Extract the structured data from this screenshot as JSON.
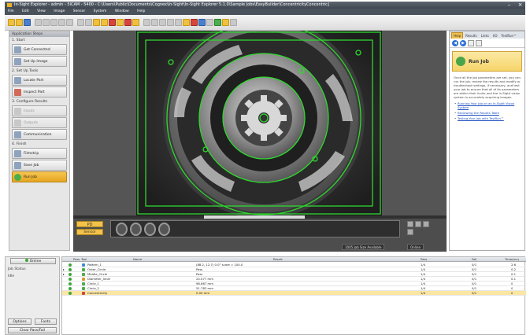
{
  "window": {
    "title": "In-Sight Explorer - admin - 5ICAM - 5400 - C:\\Users\\Public\\Documents\\Cognex\\In-Sight\\In-Sight Explorer 5.1.0\\Sample Jobs\\EasyBuilder\\ConcentricityConcentric]"
  },
  "menu": [
    "File",
    "Edit",
    "View",
    "Image",
    "Sensor",
    "System",
    "Window",
    "Help"
  ],
  "left_panel": {
    "title": "Application Steps",
    "sections": [
      {
        "label": "1. Start",
        "steps": [
          {
            "label": "Get Connected",
            "state": "normal"
          },
          {
            "label": "Set Up Image",
            "state": "normal"
          }
        ]
      },
      {
        "label": "2. Set Up Tools",
        "steps": [
          {
            "label": "Locate Part",
            "state": "normal"
          },
          {
            "label": "Inspect Part",
            "state": "normal"
          }
        ]
      },
      {
        "label": "3. Configure Results",
        "steps": [
          {
            "label": "Inputs",
            "state": "disabled"
          },
          {
            "label": "Outputs",
            "state": "disabled"
          },
          {
            "label": "Communication",
            "state": "normal"
          }
        ]
      },
      {
        "label": "4. Finish",
        "steps": [
          {
            "label": "Filmstrip",
            "state": "normal"
          },
          {
            "label": "Save Job",
            "state": "normal"
          },
          {
            "label": "Run Job",
            "state": "active"
          }
        ]
      }
    ]
  },
  "filmstrip": {
    "pass_label": "PD",
    "sensor_label": "Sensor",
    "status_left": "1005 Job Size Available",
    "status_right": "Online"
  },
  "right_panel": {
    "tabs": [
      "Help",
      "Results",
      "Links",
      "I/O",
      "TestRun™"
    ],
    "selected_tab": "Help",
    "card_title": "Run Job",
    "body": "Once all the job parameters are set, you can run the job, review the results and modify or troubleshoot settings, if necessary, and test your job to ensure that all of its parameters are within their limits and the In-Sight vision system is accurately acquiring images.",
    "links": [
      "Running Your Job on an In-Sight Vision System",
      "Reviewing the Results Table",
      "Testing Your Job with TestRun™"
    ]
  },
  "bottom_left": {
    "online_label": "Online",
    "job_status_label": "Job Status",
    "job_status_value": "Idle",
    "options_label": "Options",
    "fonts_label": "Fonts",
    "clear_label": "Clear Pass/Fail"
  },
  "results": {
    "columns": [
      "Pass",
      "Tool",
      "Name",
      "Result",
      "Pass",
      "Fail",
      "Time(ms)"
    ],
    "rows": [
      {
        "name": "Pattern_1",
        "result": "(88.2, 12.7) 0.0° score = 100.0",
        "pass": "1/4",
        "fail": "0/1",
        "time": "2.6",
        "icon": "#3a8fd8"
      },
      {
        "name": "Outer_Circle",
        "result": "Pass",
        "pass": "1/4",
        "fail": "0/1",
        "time": "0.2",
        "icon": "#4aae4a"
      },
      {
        "name": "Middle_Circle",
        "result": "Pass",
        "pass": "1/4",
        "fail": "0/1",
        "time": "0.1",
        "icon": "#4aae4a"
      },
      {
        "name": "Diameter_Inner",
        "result": "24.077 mm",
        "pass": "1/4",
        "fail": "0/1",
        "time": "0.1",
        "icon": "#d89a2a"
      },
      {
        "name": "Circle_1",
        "result": "98.667 mm",
        "pass": "1/4",
        "fail": "0/1",
        "time": "0",
        "icon": "#4aae4a"
      },
      {
        "name": "Circle_2",
        "result": "51.783 mm",
        "pass": "1/4",
        "fail": "0/1",
        "time": "0",
        "icon": "#4aae4a"
      },
      {
        "name": "Concentricity",
        "result": "0.00 mm",
        "pass": "1/4",
        "fail": "0/1",
        "time": "0",
        "icon": "#d8443a",
        "selected": true
      }
    ]
  },
  "colors": {
    "accent": "#f3c24a",
    "graphics_green": "#2ed82e",
    "pass_green": "#3aa63a"
  }
}
